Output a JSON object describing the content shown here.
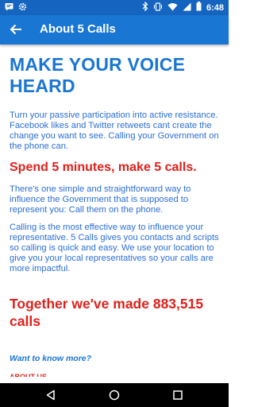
{
  "status": {
    "time": "6:48"
  },
  "appbar": {
    "title": "About 5 Calls"
  },
  "content": {
    "headline": "MAKE YOUR VOICE HEARD",
    "intro": "Turn your passive participation into active resistance. Facebook likes and Twitter retweets cant create the change you want to see. Calling your Government on the phone can.",
    "spend": "Spend 5 minutes, make 5 calls.",
    "para2": "There's one simple and straightforward way to influence the Government that is supposed to represent you: Call them on the phone.",
    "para3": "Calling is the most effective way to influence your representative. 5 Calls gives you contacts and scripts so calling is quick and easy. We use your location to give you your local representatives so your calls are more impactful.",
    "together": "Together we've made 883,515 calls",
    "more_link": "Want to know more?",
    "about_us": "ABOUT US"
  },
  "colors": {
    "status_bar": "#1565c0",
    "app_bar": "#1976d2",
    "body_text": "#2a6fd6",
    "accent_red": "#e0201a"
  }
}
